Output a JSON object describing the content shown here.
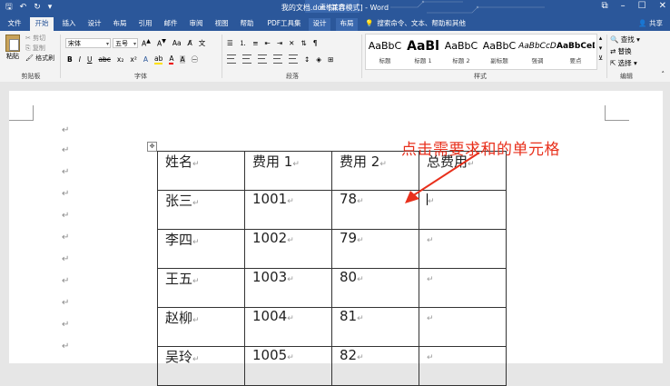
{
  "app": {
    "doc_title": "我的文档.doc [兼容模式] - Word",
    "context_tab_label": "表格工具"
  },
  "tabs": [
    "文件",
    "开始",
    "插入",
    "设计",
    "布局",
    "引用",
    "邮件",
    "审阅",
    "视图",
    "帮助",
    "PDF工具集",
    "设计",
    "布局"
  ],
  "active_tab": "开始",
  "search": {
    "placeholder": "搜索命令、文本、帮助和其他"
  },
  "share_label": "共享",
  "ribbon": {
    "clipboard": {
      "paste": "粘贴",
      "cut": "剪切",
      "copy": "复制",
      "format_painter": "格式刷",
      "label": "剪贴板"
    },
    "font": {
      "family": "宋体",
      "size": "五号",
      "label": "字体",
      "bold": "B",
      "italic": "I",
      "underline": "U",
      "strike": "abc",
      "sub": "x₂",
      "sup": "x²"
    },
    "paragraph": {
      "label": "段落"
    },
    "styles": {
      "label": "样式",
      "items": [
        {
          "sample": "AaBbC",
          "name": "标题"
        },
        {
          "sample": "AaBl",
          "name": "标题 1"
        },
        {
          "sample": "AaBbC",
          "name": "标题 2"
        },
        {
          "sample": "AaBbC",
          "name": "副标题"
        },
        {
          "sample": "AaBbCcD",
          "name": "强调"
        },
        {
          "sample": "AaBbCeD",
          "name": "要点"
        }
      ]
    },
    "editing": {
      "label": "编辑",
      "find": "查找",
      "replace": "替换",
      "select": "选择"
    }
  },
  "annotation": "点击需要求和的单元格",
  "table": {
    "rows": [
      [
        "姓名",
        "费用 1",
        "费用 2",
        "总费用"
      ],
      [
        "张三",
        "1001",
        "78",
        ""
      ],
      [
        "李四",
        "1002",
        "79",
        ""
      ],
      [
        "王五",
        "1003",
        "80",
        ""
      ],
      [
        "赵柳",
        "1004",
        "81",
        ""
      ],
      [
        "吴玲",
        "1005",
        "82",
        ""
      ]
    ]
  },
  "paragraph_mark": "↵",
  "colors": {
    "word_blue": "#2b579a",
    "annotation_red": "#e8301c"
  }
}
